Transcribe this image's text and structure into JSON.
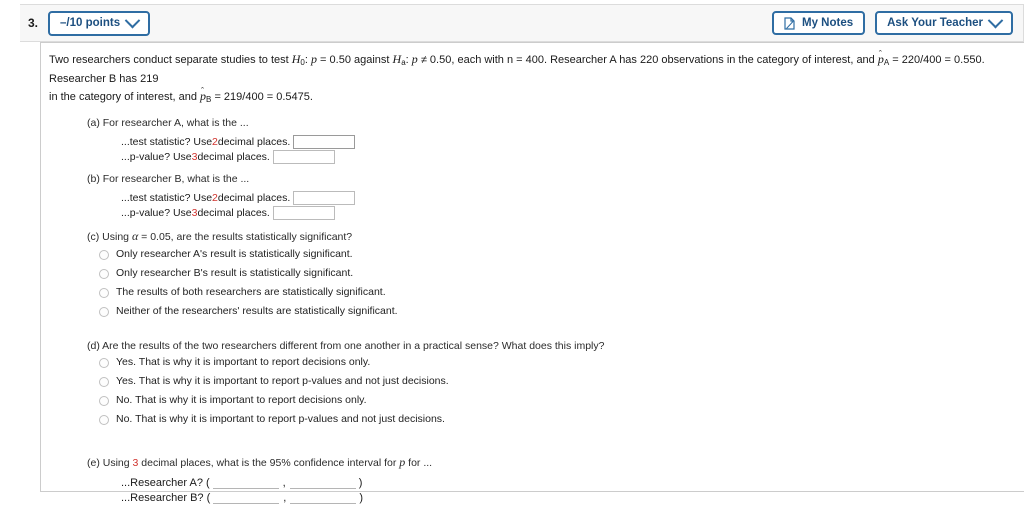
{
  "header": {
    "question_number": "3.",
    "points_label": "–/10 points",
    "points_chevron_icon": "chevron-down-icon",
    "my_notes_label": "My Notes",
    "my_notes_icon": "note-page-icon",
    "ask_teacher_label": "Ask Your Teacher",
    "ask_teacher_chevron_icon": "chevron-down-icon",
    "accent_color": "#2f6da3",
    "bar_background": "#f7f7f7"
  },
  "problem": {
    "stem_part1": "Two researchers conduct separate studies to test ",
    "h0_symbol": "H",
    "h0_sub": "0",
    "h0_statement": ": ",
    "p_symbol": "p",
    "h0_value": " = 0.50 against ",
    "ha_symbol": "H",
    "ha_sub": "a",
    "ha_statement": ": ",
    "ha_value": " ≠ 0.50, each with n = 400. Researcher A has 220 observations in the category of interest, and ",
    "phat_a_sub": "A",
    "phat_a_value": " = 220/400 = 0.550. Researcher B has 219",
    "stem_line2_prefix": "in the category of interest, and ",
    "phat_b_sub": "B",
    "phat_b_value": " = 219/400 = 0.5475."
  },
  "part_a": {
    "heading": "(a) For researcher A, what is the ...",
    "test_statistic_prefix": "...test statistic? Use ",
    "test_statistic_decimals": "2",
    "test_statistic_suffix": " decimal places.",
    "pvalue_prefix": "...p-value? Use ",
    "pvalue_decimals": "3",
    "pvalue_suffix": " decimal places.",
    "test_statistic_value": "",
    "pvalue_value": ""
  },
  "part_b": {
    "heading": "(b) For researcher B, what is the ...",
    "test_statistic_prefix": "...test statistic? Use ",
    "test_statistic_decimals": "2",
    "test_statistic_suffix": " decimal places.",
    "pvalue_prefix": "...p-value? Use ",
    "pvalue_decimals": "3",
    "pvalue_suffix": " decimal places.",
    "test_statistic_value": "",
    "pvalue_value": ""
  },
  "part_c": {
    "heading_prefix": "(c) Using ",
    "alpha_symbol": "α",
    "heading_suffix": " = 0.05, are the results statistically significant?",
    "options": [
      "Only researcher A's result is statistically significant.",
      "Only researcher B's result is statistically significant.",
      "The results of both researchers are statistically significant.",
      "Neither of the researchers' results are statistically significant."
    ],
    "selected": null
  },
  "part_d": {
    "heading": "(d) Are the results of the two researchers different from one another in a practical sense? What does this imply?",
    "options": [
      "Yes. That is why it is important to report decisions only.",
      "Yes. That is why it is important to report p-values and not just decisions.",
      "No. That is why it is important to report decisions only.",
      "No. That is why it is important to report p-values and not just decisions."
    ],
    "selected": null
  },
  "part_e": {
    "heading_prefix": "(e) Using ",
    "heading_decimals": "3",
    "heading_mid": " decimal places, what is the 95% confidence interval for ",
    "heading_p_symbol": "p",
    "heading_suffix": " for ...",
    "rows": [
      {
        "label": "...Researcher A? (",
        "lower_value": "",
        "upper_value": "",
        "separator": ",",
        "close": ")"
      },
      {
        "label": "...Researcher B? (",
        "lower_value": "",
        "upper_value": "",
        "separator": ",",
        "close": ")"
      }
    ]
  }
}
